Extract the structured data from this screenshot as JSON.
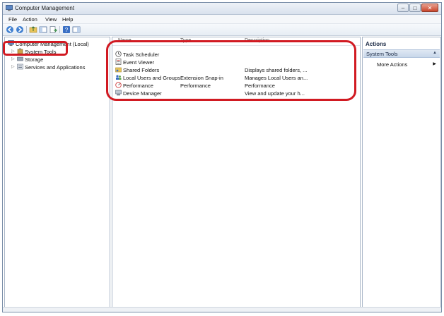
{
  "window": {
    "title": "Computer Management",
    "controls": [
      "–",
      "□",
      "✕"
    ]
  },
  "menubar": {
    "items": [
      "File",
      "Action",
      "View",
      "Help"
    ]
  },
  "tree": {
    "root": "Computer Management (Local)",
    "items": [
      {
        "label": "System Tools",
        "icon": "tools-icon",
        "selected": true
      },
      {
        "label": "Storage",
        "icon": "storage-icon"
      },
      {
        "label": "Services and Applications",
        "icon": "services-icon"
      }
    ]
  },
  "list": {
    "columns": [
      "Name",
      "Type",
      "Description"
    ],
    "rows": [
      {
        "name": "Task Scheduler",
        "type": "",
        "description": "",
        "icon": "clock-icon"
      },
      {
        "name": "Event Viewer",
        "type": "",
        "description": "",
        "icon": "event-viewer-icon"
      },
      {
        "name": "Shared Folders",
        "type": "",
        "description": "Displays shared folders, ...",
        "icon": "shared-folder-icon"
      },
      {
        "name": "Local Users and Groups",
        "type": "Extension Snap-in",
        "description": "Manages Local Users an...",
        "icon": "users-icon"
      },
      {
        "name": "Performance",
        "type": "Performance",
        "description": "Performance",
        "icon": "performance-icon"
      },
      {
        "name": "Device Manager",
        "type": "",
        "description": "View and update your h...",
        "icon": "device-manager-icon"
      }
    ]
  },
  "actions": {
    "title": "Actions",
    "section": "System Tools",
    "items": [
      "More Actions"
    ]
  },
  "colors": {
    "highlight": "#d11a22",
    "pane_border": "#a9b6c7",
    "actions_section_bg": "#c8d7ea"
  }
}
